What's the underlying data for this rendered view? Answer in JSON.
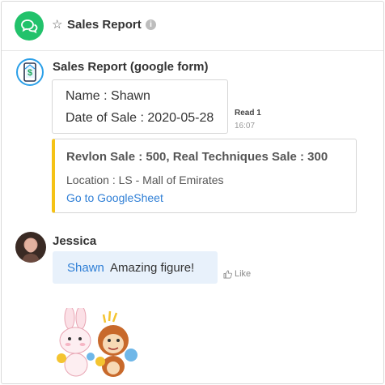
{
  "header": {
    "title": "Sales Report",
    "star_icon": "star-outline-icon",
    "info_icon": "i"
  },
  "colors": {
    "brand_green": "#22c26b",
    "form_accent": "#f5c214",
    "link_blue": "#2f7fd6",
    "bubble_bg": "#e8f1fb"
  },
  "messages": {
    "bot": {
      "name": "Sales Report (google form)",
      "lines": [
        "Name : Shawn",
        "Date of Sale : 2020-05-28"
      ],
      "read_status": "Read 1",
      "time": "16:07",
      "card": {
        "title": "Revlon Sale : 500, Real Techniques Sale : 300",
        "location": "Location : LS - Mall of Emirates",
        "link": "Go to GoogleSheet"
      }
    },
    "user": {
      "name": "Jessica",
      "mention": "Shawn",
      "text": "Amazing figure!",
      "like_label": "Like"
    }
  }
}
